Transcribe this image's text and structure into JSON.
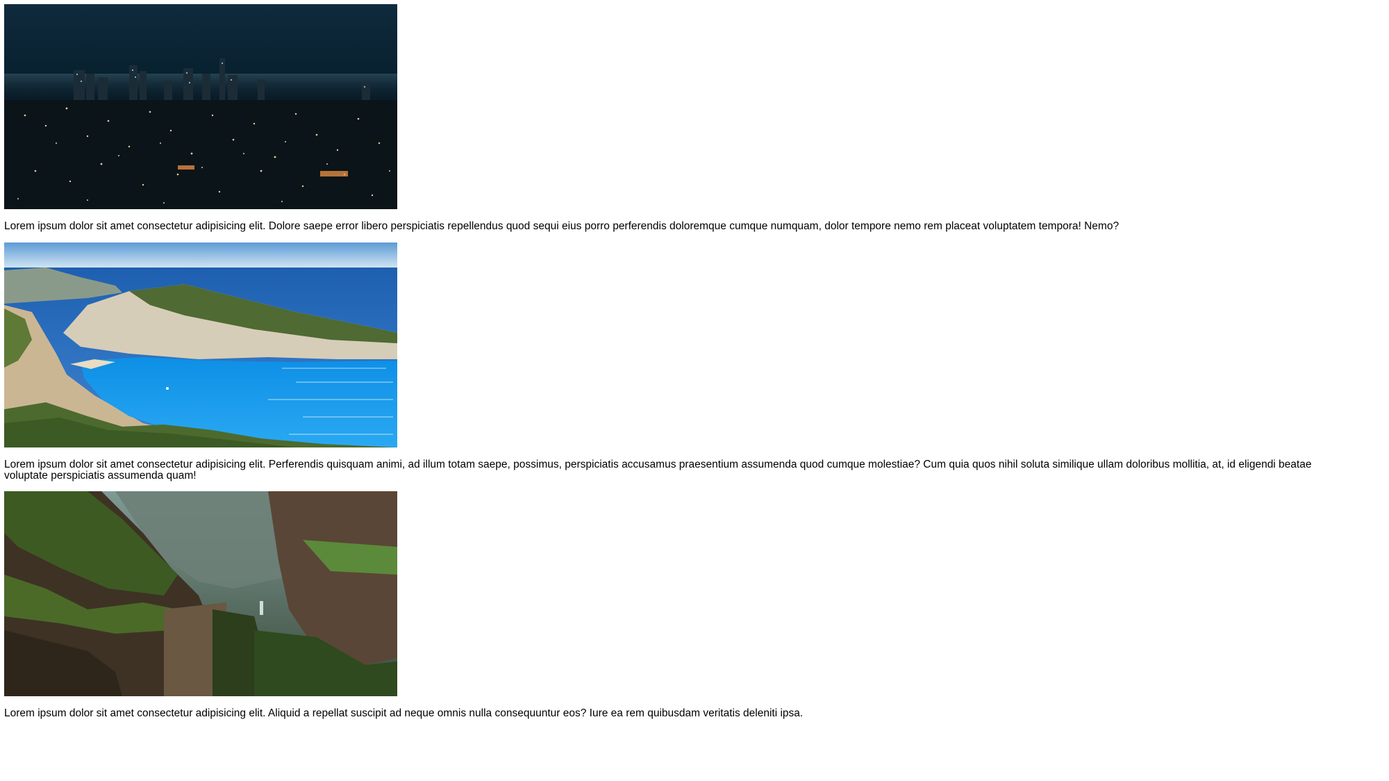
{
  "posts": [
    {
      "image": "city-skyline-night-photo",
      "caption": "Lorem ipsum dolor sit amet consectetur adipisicing elit. Dolore saepe error libero perspiciatis repellendus quod sequi eius porro perferendis doloremque cumque numquam, dolor tempore nemo rem placeat voluptatem tempora! Nemo?"
    },
    {
      "image": "coastal-bay-cliff-photo",
      "caption": "Lorem ipsum dolor sit amet consectetur adipisicing elit. Perferendis quisquam animi, ad illum totam saepe, possimus, perspiciatis accusamus praesentium assumenda quod cumque molestiae? Cum quia quos nihil soluta similique ullam doloribus mollitia, at, id eligendi beatae voluptate perspiciatis assumenda quam!"
    },
    {
      "image": "green-canyon-photo",
      "caption": "Lorem ipsum dolor sit amet consectetur adipisicing elit. Aliquid a repellat suscipit ad neque omnis nulla consequuntur eos? Iure ea rem quibusdam veritatis deleniti ipsa."
    }
  ],
  "colors": {
    "background": "#ffffff",
    "text": "#000000",
    "night_sky": "#0c2236",
    "sea": "#1f9fe8",
    "canyon_green": "#2f4a1e"
  }
}
